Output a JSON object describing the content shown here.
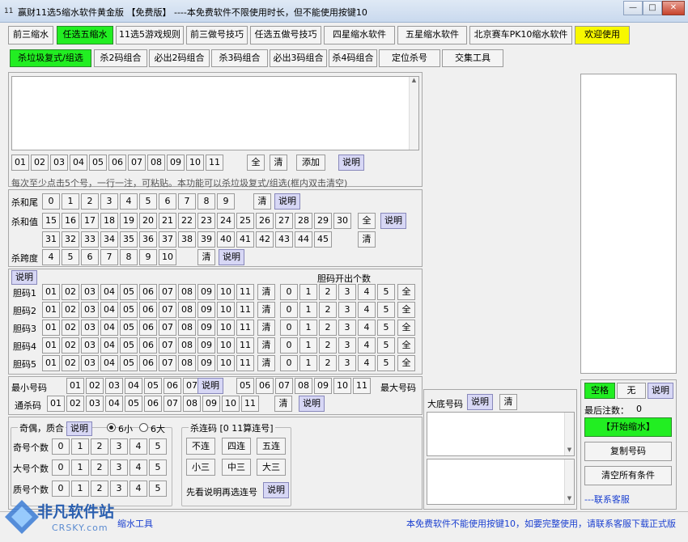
{
  "window": {
    "title": "赢财11选5缩水软件黄金版      【免费版】 ----本免费软件不限使用时长，但不能使用按键10",
    "icon_text": "11",
    "minimize_icon": "minimize-icon",
    "maximize_icon": "maximize-icon",
    "close_icon": "close-icon"
  },
  "tabs": [
    {
      "label": "前三缩水"
    },
    {
      "label": "任选五缩水"
    },
    {
      "label": "11选5游戏规则"
    },
    {
      "label": "前三做号技巧"
    },
    {
      "label": "任选五做号技巧"
    },
    {
      "label": "四星缩水软件"
    },
    {
      "label": "五星缩水软件"
    },
    {
      "label": "北京赛车PK10缩水软件"
    },
    {
      "label": "欢迎使用"
    }
  ],
  "subtabs": [
    {
      "label": "杀垃圾复式/组选"
    },
    {
      "label": "杀2码组合"
    },
    {
      "label": "必出2码组合"
    },
    {
      "label": "杀3码组合"
    },
    {
      "label": "必出3码组合"
    },
    {
      "label": "杀4码组合"
    },
    {
      "label": "定位杀号"
    },
    {
      "label": "交集工具"
    }
  ],
  "section1": {
    "nums": [
      "01",
      "02",
      "03",
      "04",
      "05",
      "06",
      "07",
      "08",
      "09",
      "10",
      "11"
    ],
    "all": "全",
    "clear": "清",
    "add": "添加",
    "help": "说明",
    "hint": "每次至少点击5个号，一行一注，可粘贴。本功能可以杀垃圾复式/组选(框内双击清空)"
  },
  "section2": {
    "tail_label": "杀和尾",
    "tail_nums": [
      "0",
      "1",
      "2",
      "3",
      "4",
      "5",
      "6",
      "7",
      "8",
      "9"
    ],
    "sum_label": "杀和值",
    "sum_row1": [
      "15",
      "16",
      "17",
      "18",
      "19",
      "20",
      "21",
      "22",
      "23",
      "24",
      "25",
      "26",
      "27",
      "28",
      "29",
      "30"
    ],
    "sum_row2": [
      "31",
      "32",
      "33",
      "34",
      "35",
      "36",
      "37",
      "38",
      "39",
      "40",
      "41",
      "42",
      "43",
      "44",
      "45"
    ],
    "span_label": "杀跨度",
    "span_nums": [
      "4",
      "5",
      "6",
      "7",
      "8",
      "9",
      "10"
    ],
    "clear": "清",
    "all": "全",
    "help": "说明"
  },
  "section3": {
    "help": "说明",
    "count_title": "胆码开出个数",
    "rows": [
      "胆码1",
      "胆码2",
      "胆码3",
      "胆码4",
      "胆码5"
    ],
    "nums": [
      "01",
      "02",
      "03",
      "04",
      "05",
      "06",
      "07",
      "08",
      "09",
      "10",
      "11"
    ],
    "counts": [
      "0",
      "1",
      "2",
      "3",
      "4",
      "5"
    ],
    "clear": "清",
    "all": "全"
  },
  "section4": {
    "min_label": "最小号码",
    "min_nums": [
      "01",
      "02",
      "03",
      "04",
      "05",
      "06",
      "07"
    ],
    "max_nums": [
      "05",
      "06",
      "07",
      "08",
      "09",
      "10",
      "11"
    ],
    "max_label": "最大号码",
    "help": "说明",
    "kill_label": "通杀码",
    "kill_nums": [
      "01",
      "02",
      "03",
      "04",
      "05",
      "06",
      "07",
      "08",
      "09",
      "10",
      "11"
    ],
    "clear": "清"
  },
  "odd_group": {
    "title": "奇偶，质合",
    "help": "说明",
    "radio1": "6小",
    "radio2": "6大",
    "rows": [
      "奇号个数",
      "大号个数",
      "质号个数"
    ],
    "counts": [
      "0",
      "1",
      "2",
      "3",
      "4",
      "5"
    ]
  },
  "consec_group": {
    "title": "杀连码 [0 11算连号]",
    "b1": "不连",
    "b2": "四连",
    "b3": "五连",
    "b4": "小三",
    "b5": "中三",
    "b6": "大三",
    "note": "先看说明再选连号",
    "help": "说明"
  },
  "base_panel": {
    "label": "大底号码",
    "help": "说明",
    "clear": "清"
  },
  "right_panel": {
    "space_btn": "空格",
    "none_btn": "无",
    "help": "说明",
    "count_label": "最后注数：",
    "count_value": "0",
    "start": "【开始缩水】",
    "copy": "复制号码",
    "clear_all": "清空所有条件",
    "contact": "---联系客服"
  },
  "status": {
    "left_text": "缩水工具",
    "right_text": "本免费软件不能使用按键10，如要完整使用，请联系客服下载正式版"
  },
  "watermark": {
    "cn": "非凡软件站",
    "en": "CRSKY.com"
  },
  "colors": {
    "active_tab": "#22ee22",
    "welcome_tab": "#f8f800",
    "help_button": "#d7d7f5",
    "status_text": "#1a3fd0"
  }
}
